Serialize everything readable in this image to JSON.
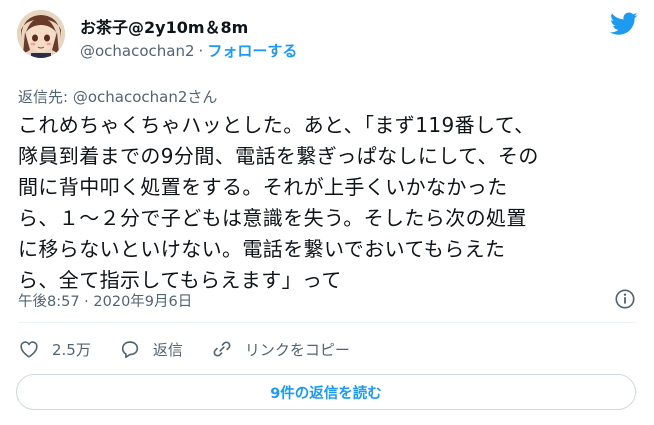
{
  "user": {
    "display_name": "お茶子@2y10m＆8m",
    "handle": "@ochacochan2",
    "separator": "·",
    "follow_label": "フォローする"
  },
  "reply_to": {
    "prefix": "返信先: ",
    "handle": "@ochacochan2さん"
  },
  "tweet": {
    "lines": [
      "これめちゃくちゃハッとした。あと、「まず119番して、",
      "隊員到着までの9分間、電話を繋ぎっぱなしにして、その",
      "間に背中叩く処置をする。それが上手くいかなかった",
      "ら、１～２分で子どもは意識を失う。そしたら次の処置",
      "に移らないといけない。電話を繋いでおいてもらえた",
      "ら、全て指示してもらえます」って"
    ],
    "timestamp": "午後8:57 · 2020年9月6日"
  },
  "actions": {
    "like_count": "2.5万",
    "reply_label": "返信",
    "copy_link_label": "リンクをコピー"
  },
  "replies_button": {
    "label": "9件の返信を読む"
  },
  "colors": {
    "accent": "#1d9bf0",
    "text": "#0f1419",
    "secondary": "#536471"
  }
}
